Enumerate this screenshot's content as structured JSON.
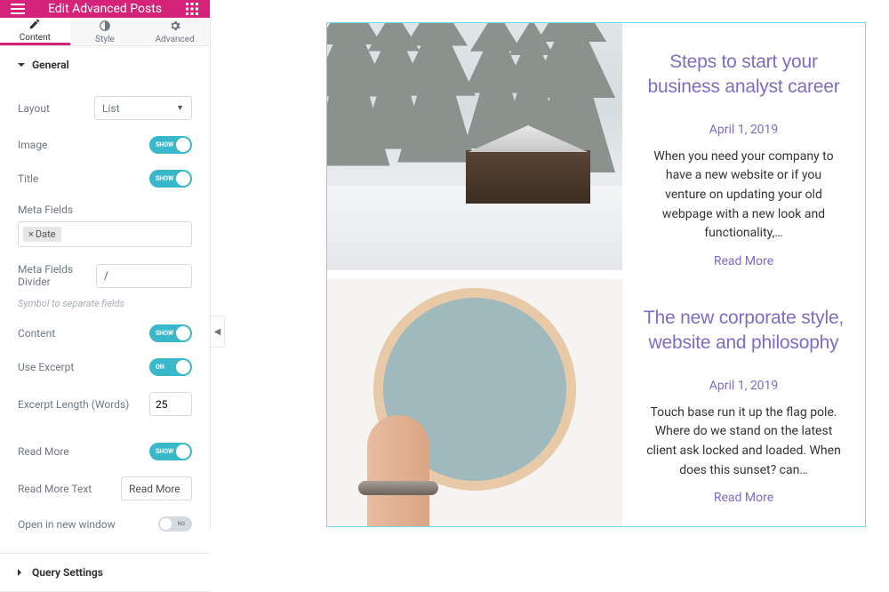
{
  "header": {
    "title": "Edit Advanced Posts"
  },
  "tabs": [
    {
      "label": "Content",
      "icon": "pencil-icon",
      "active": true
    },
    {
      "label": "Style",
      "icon": "contrast-icon",
      "active": false
    },
    {
      "label": "Advanced",
      "icon": "gear-icon",
      "active": false
    }
  ],
  "sections": {
    "general": {
      "title": "General",
      "layout_label": "Layout",
      "layout_value": "List",
      "image_label": "Image",
      "image_on": "SHOW",
      "title_label": "Title",
      "title_on": "SHOW",
      "metafields_label": "Meta Fields",
      "metafields_tag": "Date",
      "divider_label": "Meta Fields Divider",
      "divider_value": "/",
      "divider_hint": "Symbol to separate fields",
      "content_label": "Content",
      "content_on": "SHOW",
      "excerpt_label": "Use Excerpt",
      "excerpt_on": "ON",
      "excerpt_len_label": "Excerpt Length (Words)",
      "excerpt_len_value": "25",
      "readmore_label": "Read More",
      "readmore_on": "SHOW",
      "readmore_text_label": "Read More Text",
      "readmore_text_value": "Read More",
      "newwin_label": "Open in new window",
      "newwin_off": "NO"
    },
    "query": {
      "title": "Query Settings"
    }
  },
  "posts": [
    {
      "title": "Steps to start your business analyst career",
      "date": "April 1, 2019",
      "excerpt": "When you need your company to have a new website or if you venture on updating your old webpage with a new look and functionality,…",
      "more": "Read More"
    },
    {
      "title": "The new corporate style, website and philosophy",
      "date": "April 1, 2019",
      "excerpt": "Touch base run it up the flag pole. Where do we stand on the latest client ask locked and loaded. When does this sunset? can…",
      "more": "Read More"
    }
  ]
}
